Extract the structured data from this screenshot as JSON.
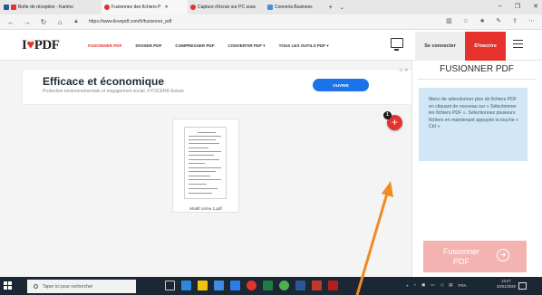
{
  "browser": {
    "tabs": [
      {
        "label": "Boîte de réception - Karimo",
        "color": "#e5322d",
        "active": false
      },
      {
        "label": "Fusionnez des fichiers P",
        "color": "#e5322d",
        "active": true
      },
      {
        "label": "Capture d'écran sur PC sous",
        "color": "#e5322d",
        "active": false
      },
      {
        "label": "Converia Business",
        "color": "#4a90d9",
        "active": false
      }
    ],
    "url": "https://www.ilovepdf.com/fr/fusionner_pdf"
  },
  "site": {
    "logo_text_left": "I",
    "logo_heart": "♥",
    "logo_text_right": "PDF",
    "menu": {
      "merge": "FUSIONNER PDF",
      "split": "DIVISER PDF",
      "compress": "COMPRESSER PDF",
      "convert": "CONVERTIR PDF ▾",
      "all_tools": "TOUS LES OUTILS PDF ▾"
    },
    "login": "Se connecter",
    "signup": "S'inscrire"
  },
  "ad": {
    "title": "Efficace et économique",
    "subtitle": "Protection environnementale et engagement social. KYOCERA Suisse",
    "button": "OUVRIR",
    "marker": "▷ ✕"
  },
  "file": {
    "name": "Modif corne 1.pdf",
    "count": "1"
  },
  "panel": {
    "title": "FUSIONNER PDF",
    "info": "Merci de sélectionner plus de fichiers PDF en cliquant de nouveau sur « Sélectionner les fichiers PDF ». Sélectionnez plusieurs fichiers en maintenant appuyée la touche « Ctrl »",
    "merge_button": "Fusionner PDF"
  },
  "taskbar": {
    "search_placeholder": "Taper ici pour rechercher",
    "lang": "FRA",
    "time": "10:47",
    "date": "30/01/2020"
  },
  "colors": {
    "brand": "#e5322d",
    "info_bg": "#d2e7f5",
    "annotation_arrow": "#f08a24"
  }
}
